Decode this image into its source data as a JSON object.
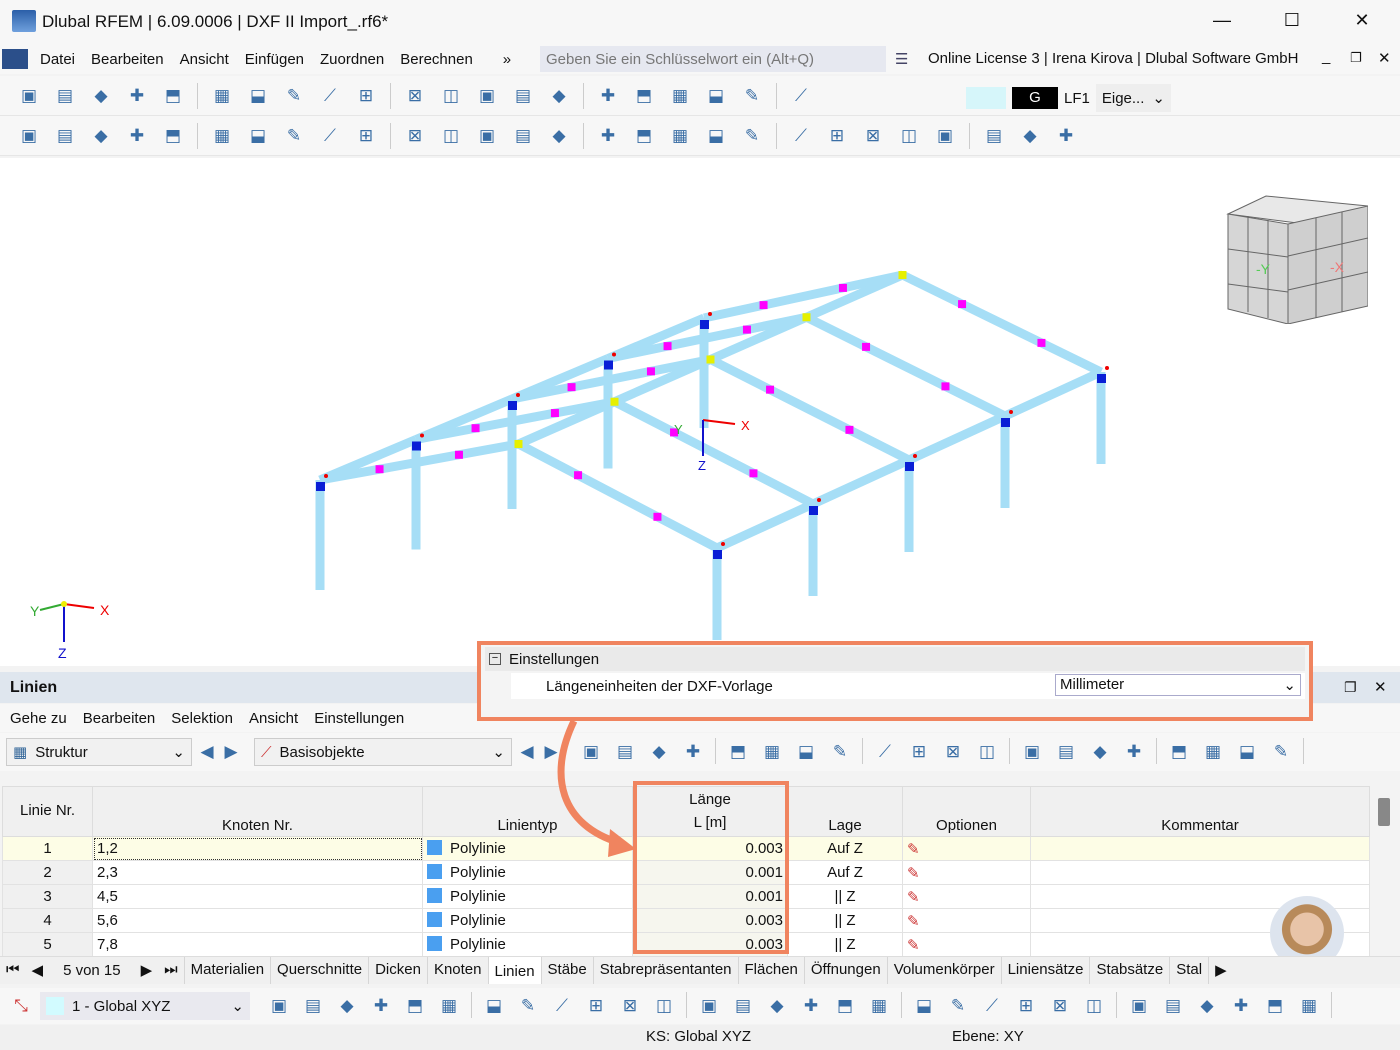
{
  "window": {
    "title": "Dlubal RFEM | 6.09.0006 | DXF II Import_.rf6*",
    "minimize": "—",
    "maximize": "☐",
    "close": "✕"
  },
  "menu": [
    "Datei",
    "Bearbeiten",
    "Ansicht",
    "Einfügen",
    "Zuordnen",
    "Berechnen"
  ],
  "menu_more": "»",
  "search": {
    "placeholder": "Geben Sie ein Schlüsselwort ein (Alt+Q)"
  },
  "license": "Online License 3 | Irena Kirova | Dlubal Software GmbH",
  "toolbar1": {
    "load_case_color": "G",
    "load_case": "LF1",
    "load_combo": "Eige..."
  },
  "toolbar_icons1": [
    "new-model-icon",
    "open-icon",
    "dlubal-center-icon",
    "model-icon",
    "print-report-icon",
    "save-icon",
    "print-icon",
    "export-icon",
    "report-icon",
    "undo-icon",
    "redo-icon",
    "table-icon",
    "grid-icon",
    "dimension-icon",
    "list-icon",
    "console-icon",
    "script-icon",
    "document-icon",
    "user-icon",
    "select-icon",
    "load-icon"
  ],
  "toolbar_icons2": [
    "node-icon",
    "line-icon",
    "member-icon",
    "polyline-icon",
    "support-icon",
    "hinge-icon",
    "section-icon",
    "surface-icon",
    "solid-icon",
    "opening-icon",
    "box-icon",
    "column-icon",
    "load-node-icon",
    "load-line-icon",
    "load-member-icon",
    "load-surface-icon",
    "coordinate-icon",
    "mesh-icon",
    "filter-icon",
    "result-diagram-icon",
    "section-cut-icon",
    "model-view-icon",
    "deformation-icon",
    "plate-icon",
    "cube-icon",
    "arrow-icon",
    "slider-icon",
    "grid-view-icon"
  ],
  "viewport": {
    "axis_x": "X",
    "axis_y": "Y",
    "axis_z": "Z",
    "cube_y": "-Y",
    "cube_x": "-X"
  },
  "settings": {
    "group": "Einstellungen",
    "property": "Längeneinheiten der DXF-Vorlage",
    "value": "Millimeter"
  },
  "panel": {
    "title": "Linien",
    "menu": [
      "Gehe zu",
      "Bearbeiten",
      "Selektion",
      "Ansicht",
      "Einstellungen"
    ],
    "combo1": "Struktur",
    "combo2": "Basisobjekte"
  },
  "table": {
    "headers": {
      "nr": "Linie Nr.",
      "nodes": "Knoten Nr.",
      "type": "Linientyp",
      "length_top": "Länge",
      "length": "L [m]",
      "position": "Lage",
      "options": "Optionen",
      "comment": "Kommentar"
    },
    "rows": [
      {
        "nr": "1",
        "nodes": "1,2",
        "type": "Polylinie",
        "length": "0.003",
        "position": "Auf Z"
      },
      {
        "nr": "2",
        "nodes": "2,3",
        "type": "Polylinie",
        "length": "0.001",
        "position": "Auf Z"
      },
      {
        "nr": "3",
        "nodes": "4,5",
        "type": "Polylinie",
        "length": "0.001",
        "position": "|| Z"
      },
      {
        "nr": "4",
        "nodes": "5,6",
        "type": "Polylinie",
        "length": "0.003",
        "position": "|| Z"
      },
      {
        "nr": "5",
        "nodes": "7,8",
        "type": "Polylinie",
        "length": "0.003",
        "position": "|| Z"
      }
    ]
  },
  "pager": "5 von 15",
  "tabs": [
    "Materialien",
    "Querschnitte",
    "Dicken",
    "Knoten",
    "Linien",
    "Stäbe",
    "Stabrepräsentanten",
    "Flächen",
    "Öffnungen",
    "Volumenkörper",
    "Liniensätze",
    "Stabsätze",
    "Stal"
  ],
  "active_tab": "Linien",
  "coord_system": "1 - Global XYZ",
  "status": {
    "ks": "KS: Global XYZ",
    "plane": "Ebene: XY"
  },
  "colors": {
    "highlight": "#f0845f",
    "member": "#9ed8f4",
    "accent": "#4a9ff0"
  }
}
